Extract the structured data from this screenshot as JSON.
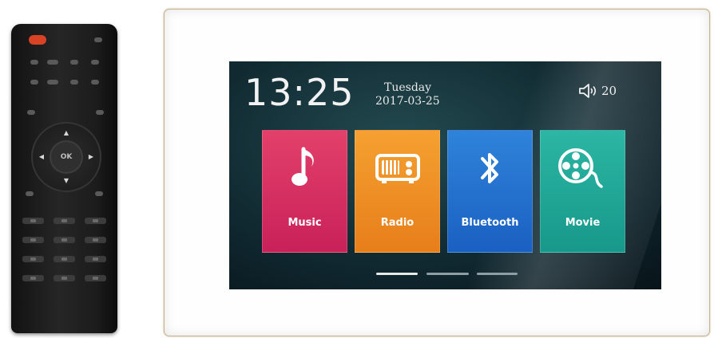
{
  "screen": {
    "time": "13:25",
    "day": "Tuesday",
    "date": "2017-03-25",
    "volume": "20",
    "volume_icon": "speaker-icon",
    "apps": [
      {
        "label": "Music",
        "icon": "music-note-icon",
        "color": "#d62e62"
      },
      {
        "label": "Radio",
        "icon": "radio-icon",
        "color": "#ef8f25"
      },
      {
        "label": "Bluetooth",
        "icon": "bluetooth-icon",
        "color": "#2472ce"
      },
      {
        "label": "Movie",
        "icon": "film-reel-icon",
        "color": "#22a797"
      }
    ],
    "pages": {
      "count": 3,
      "active": 1
    }
  },
  "remote": {
    "ok_label": "OK",
    "power_color": "#d84325"
  }
}
